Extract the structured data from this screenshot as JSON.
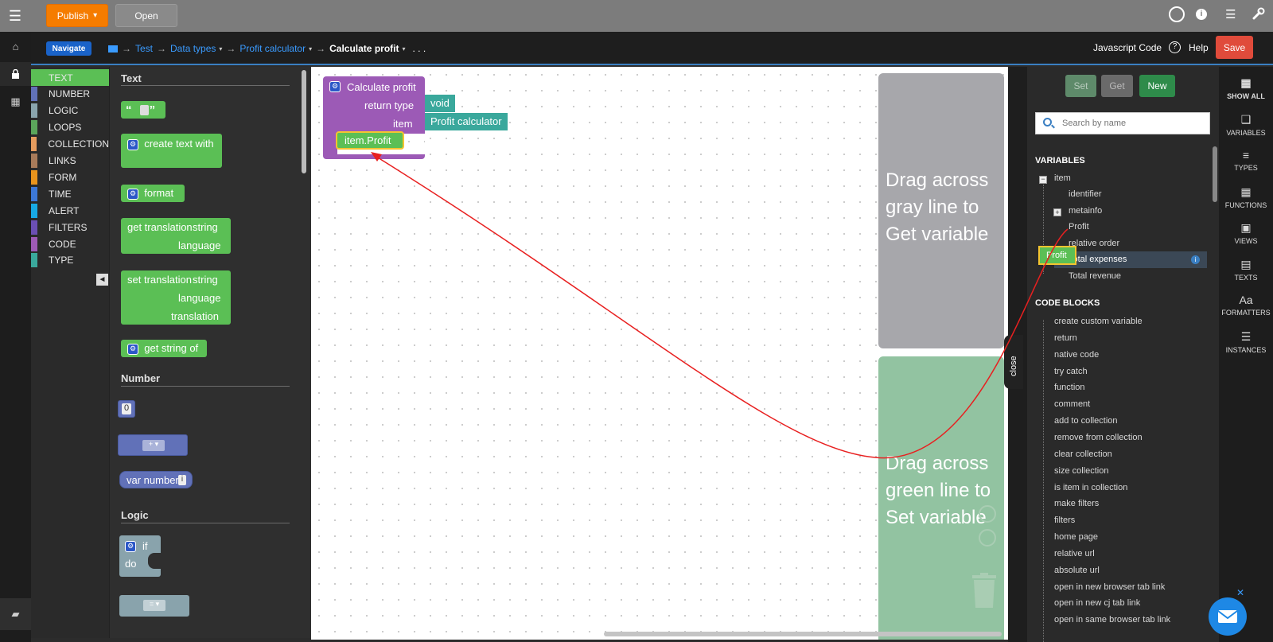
{
  "topbar": {
    "publish_label": "Publish",
    "publish_caret": "▾",
    "open_label": "Open",
    "menu_icon": "☰",
    "user_icon": "user-circle",
    "info_icon": "i",
    "list_icon": "☰",
    "wrench_icon": "wrench"
  },
  "subbar": {
    "navigate_label": "Navigate",
    "breadcrumb": [
      "Test",
      "Data types",
      "Profit calculator",
      "Calculate profit"
    ],
    "more": ". . .",
    "js_code_label": "Javascript Code",
    "help_label": "Help",
    "save_label": "Save"
  },
  "categories": [
    {
      "label": "TEXT",
      "color": "#5bbf55"
    },
    {
      "label": "NUMBER",
      "color": "#6171b8"
    },
    {
      "label": "LOGIC",
      "color": "#8aa4ad"
    },
    {
      "label": "LOOPS",
      "color": "#5ba55b"
    },
    {
      "label": "COLLECTION",
      "color": "#e69c5e"
    },
    {
      "label": "LINKS",
      "color": "#a87b5a"
    },
    {
      "label": "FORM",
      "color": "#e9941d"
    },
    {
      "label": "TIME",
      "color": "#3c78d8"
    },
    {
      "label": "ALERT",
      "color": "#17a9e5"
    },
    {
      "label": "FILTERS",
      "color": "#6b4fb3"
    },
    {
      "label": "CODE",
      "color": "#9d5ab5"
    },
    {
      "label": "TYPE",
      "color": "#3aa89c"
    }
  ],
  "flyout": {
    "sections": [
      "Text",
      "Number",
      "Logic"
    ],
    "text_blocks": {
      "quote": "“ ”",
      "create_text_with": "create text with",
      "format": "format",
      "get_translation": "get translation",
      "string": "string",
      "language": "language",
      "set_translation": "set translation",
      "translation": "translation",
      "get_string_of": "get string of"
    },
    "number_blocks": {
      "zero": "0",
      "plus": "+ ▾",
      "var_number": "var number",
      "var_i": "i"
    },
    "logic_blocks": {
      "if": "if",
      "do": "do",
      "eq": "= ▾"
    },
    "close_label": "close"
  },
  "canvas": {
    "func_block": {
      "title": "Calculate profit",
      "return_type_label": "return type",
      "return_type_value": "void",
      "item_label": "item",
      "item_value": "Profit calculator",
      "statement": "item.Profit"
    },
    "gray_zone_text": "Drag across gray line to Get variable",
    "green_zone_text": "Drag across green line to Set variable",
    "close_label": "close"
  },
  "rightpanel": {
    "set_label": "Set",
    "get_label": "Get",
    "new_label": "New",
    "search_placeholder": "Search by name",
    "variables_heading": "VARIABLES",
    "tree": {
      "item": "item",
      "identifier": "identifier",
      "metainfo": "metainfo",
      "profit": "Profit",
      "relative_order": "relative order",
      "total_expenses": "Total expenses",
      "total_revenue": "Total revenue"
    },
    "drag_ghost": "Profit",
    "code_blocks_heading": "CODE BLOCKS",
    "code_blocks": [
      "create custom variable",
      "return",
      "native code",
      "try catch",
      "function",
      "comment",
      "add to collection",
      "remove from collection",
      "clear collection",
      "size collection",
      "is item in collection",
      "make filters",
      "filters",
      "home page",
      "relative url",
      "absolute url",
      "open in new browser tab link",
      "open in new cj tab link",
      "open in same browser tab link"
    ]
  },
  "rightstrip": [
    {
      "label": "SHOW ALL",
      "icon": "▦"
    },
    {
      "label": "VARIABLES",
      "icon": "❑"
    },
    {
      "label": "TYPES",
      "icon": "≡"
    },
    {
      "label": "FUNCTIONS",
      "icon": "▦"
    },
    {
      "label": "VIEWS",
      "icon": "▣"
    },
    {
      "label": "TEXTS",
      "icon": "▤"
    },
    {
      "label": "FORMATTERS",
      "icon": "Aa"
    },
    {
      "label": "INSTANCES",
      "icon": "☰"
    }
  ],
  "colors": {
    "accent_blue": "#3a7fc2",
    "publish_orange": "#f57c00",
    "save_red": "#e04b3b",
    "text_green": "#5bbf55",
    "func_purple": "#9c5ab6",
    "teal": "#3aa89c"
  }
}
